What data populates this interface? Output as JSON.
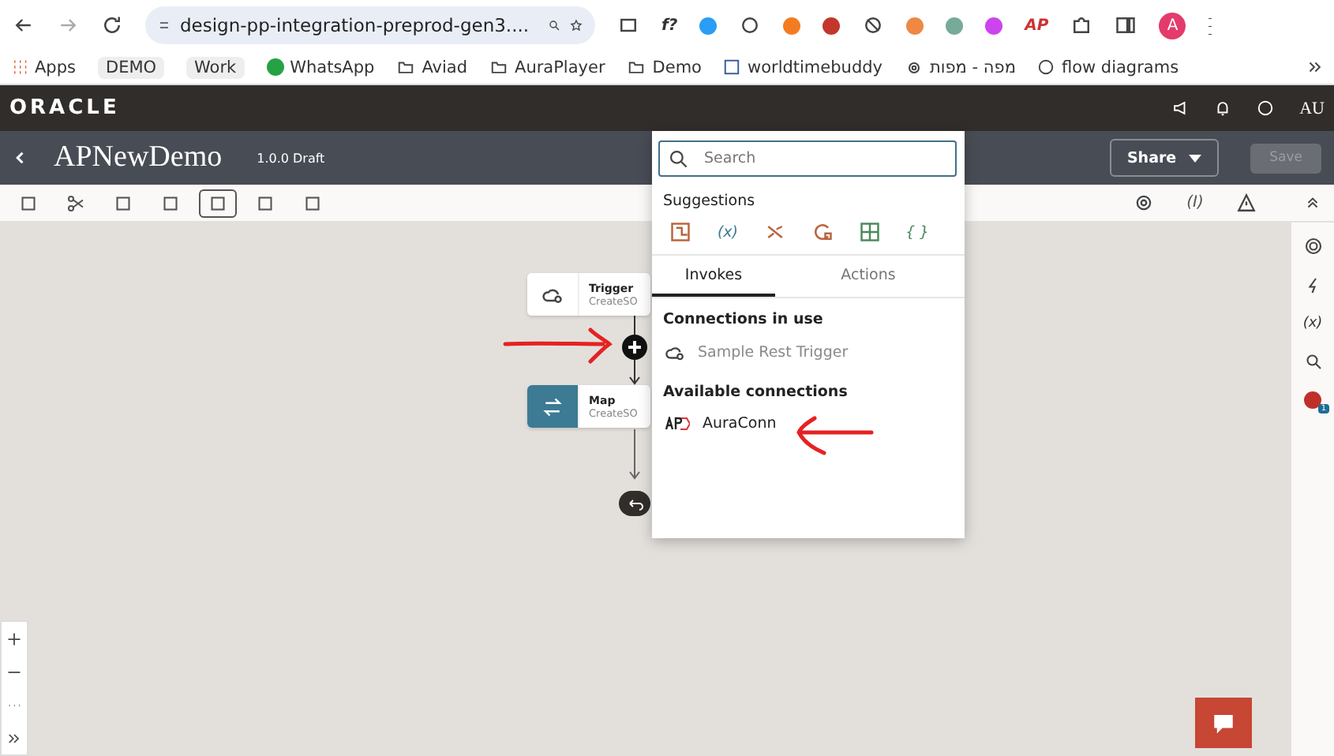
{
  "browser": {
    "url": "design-pp-integration-preprod-gen3....",
    "extension_labels": [
      "f?",
      "AP"
    ],
    "avatar": "A",
    "bookmarks": [
      {
        "label": "Apps",
        "kind": "apps"
      },
      {
        "label": "DEMO",
        "kind": "chip"
      },
      {
        "label": "Work",
        "kind": "chip"
      },
      {
        "label": "WhatsApp",
        "kind": "whatsapp"
      },
      {
        "label": "Aviad",
        "kind": "folder"
      },
      {
        "label": "AuraPlayer",
        "kind": "folder"
      },
      {
        "label": "Demo",
        "kind": "folder"
      },
      {
        "label": "worldtimebuddy",
        "kind": "clock"
      },
      {
        "label": "מפה - מפות",
        "kind": "gear"
      },
      {
        "label": "flow diagrams",
        "kind": "globe"
      }
    ]
  },
  "app_header": {
    "logo": "ORACLE",
    "user": "AU"
  },
  "title_bar": {
    "title": "APNewDemo",
    "version": "1.0.0 Draft",
    "share": "Share",
    "save": {
      "label": "Save",
      "disabled": true
    }
  },
  "toolbar": {
    "variables_label": "(I)",
    "layouts": [
      {
        "selected": true
      },
      {
        "selected": false
      },
      {
        "selected": false
      }
    ]
  },
  "canvas": {
    "nodes": [
      {
        "kind": "trigger",
        "title": "Trigger",
        "subtitle": "CreateSO"
      },
      {
        "kind": "map",
        "title": "Map",
        "subtitle": "CreateSO"
      }
    ]
  },
  "popup": {
    "search": {
      "placeholder": "Search"
    },
    "suggestions_title": "Suggestions",
    "suggestions": [
      {
        "kind": "icon"
      },
      {
        "kind": "text",
        "label": "(x)"
      },
      {
        "kind": "icon"
      },
      {
        "kind": "icon"
      },
      {
        "kind": "icon"
      },
      {
        "kind": "text",
        "label": "{ }"
      }
    ],
    "tabs": [
      {
        "label": "Invokes",
        "selected": true
      },
      {
        "label": "Actions",
        "selected": false
      }
    ],
    "sections": [
      {
        "title": "Connections in use",
        "items": [
          {
            "label": "Sample Rest Trigger",
            "kind": "trigger",
            "disabled": true
          }
        ]
      },
      {
        "title": "Available connections",
        "items": [
          {
            "label": "AuraConn",
            "kind": "ap",
            "disabled": false
          }
        ]
      }
    ]
  },
  "right_rail": {
    "variables_label": "(x)",
    "badge": "1"
  }
}
